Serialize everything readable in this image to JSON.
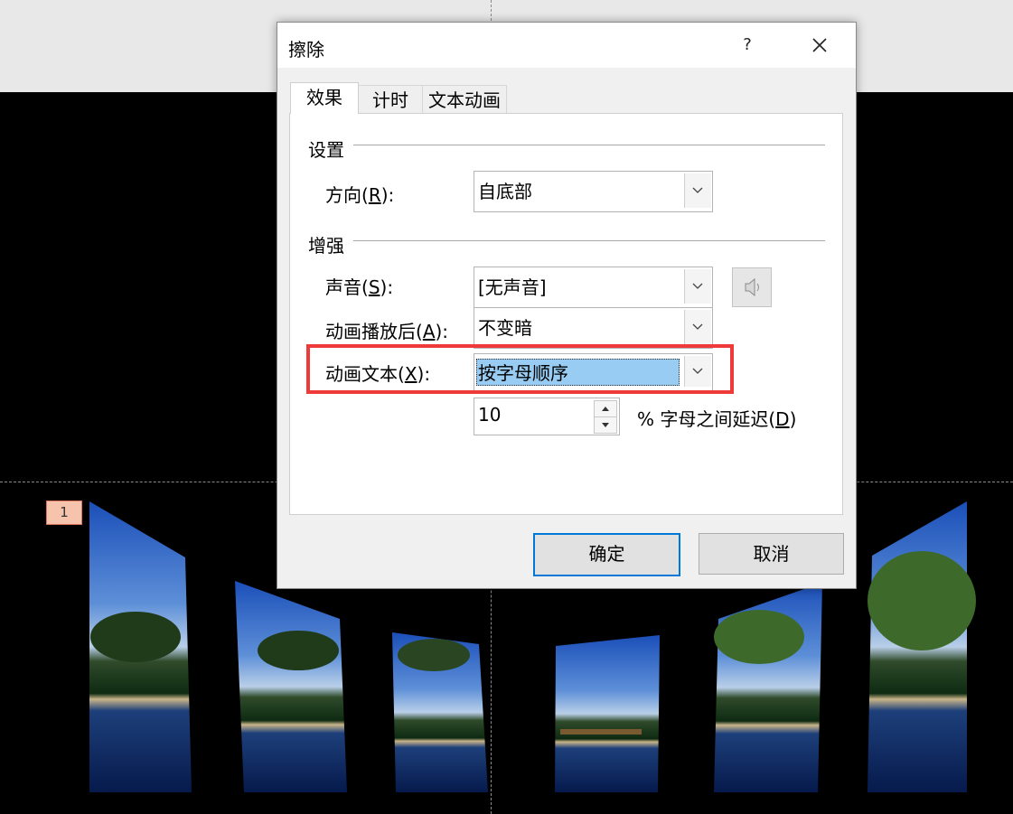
{
  "dialog": {
    "title": "擦除",
    "help": "?",
    "tabs": [
      {
        "label": "效果",
        "active": true
      },
      {
        "label": "计时",
        "active": false
      },
      {
        "label": "文本动画",
        "active": false
      }
    ],
    "settings": {
      "group_label": "设置",
      "direction": {
        "label_pre": "方向(",
        "key": "R",
        "label_post": "):",
        "value": "自底部"
      }
    },
    "enhancements": {
      "group_label": "增强",
      "sound": {
        "label_pre": "声音(",
        "key": "S",
        "label_post": "):",
        "value": "[无声音]"
      },
      "after_animation": {
        "label_pre": "动画播放后(",
        "key": "A",
        "label_post": "):",
        "value": "不变暗"
      },
      "animate_text": {
        "label_pre": "动画文本(",
        "key": "X",
        "label_post": "):",
        "value": "按字母顺序"
      },
      "delay": {
        "value": "10",
        "label_pre": "% 字母之间延迟(",
        "key": "D",
        "label_post": ")"
      }
    },
    "buttons": {
      "ok": "确定",
      "cancel": "取消"
    }
  },
  "slide": {
    "number": "1"
  },
  "colors": {
    "highlight": "#ef3a3a",
    "selection": "#99ccf2",
    "primary_border": "#0078d7"
  }
}
